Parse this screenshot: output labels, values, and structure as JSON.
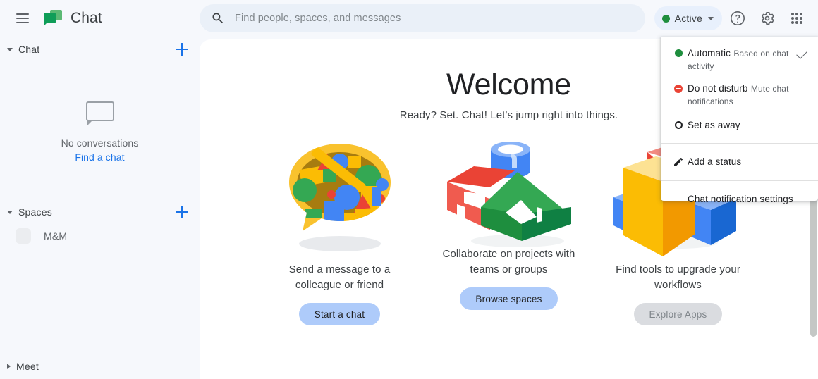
{
  "header": {
    "menu_icon": "hamburger-icon",
    "app_name": "Chat",
    "logo_icon": "google-chat-logo",
    "search": {
      "icon": "search-icon",
      "placeholder": "Find people, spaces, and messages",
      "value": ""
    },
    "status_pill": {
      "label": "Active",
      "dot_color": "#1e8e3e",
      "chevron_icon": "chevron-down-icon"
    },
    "help_icon": "help-circle-icon",
    "settings_icon": "gear-icon",
    "apps_icon": "apps-grid-icon"
  },
  "sidebar": {
    "chat_section": {
      "title": "Chat",
      "expanded": true,
      "add_icon": "plus-icon",
      "empty_state": {
        "icon": "chat-bubble-icon",
        "text": "No conversations",
        "link": "Find a chat"
      }
    },
    "spaces_section": {
      "title": "Spaces",
      "expanded": true,
      "add_icon": "plus-icon",
      "items": [
        {
          "name": "M&M",
          "avatar": "space-avatar"
        }
      ]
    },
    "meet_section": {
      "title": "Meet",
      "expanded": false
    }
  },
  "main": {
    "title": "Welcome",
    "subtitle": "Ready? Set. Chat! Let's jump right into things.",
    "cards": [
      {
        "art": "speech-bubble-with-shapes-illustration",
        "text": "Send a message to a colleague or friend",
        "button": "Start a chat",
        "disabled": false
      },
      {
        "art": "three-3d-shapes-illustration",
        "text": "Collaborate on projects with teams or groups",
        "button": "Browse spaces",
        "disabled": false
      },
      {
        "art": "3d-blocks-illustration",
        "text": "Find tools to upgrade your workflows",
        "button": "Explore Apps",
        "disabled": true
      }
    ]
  },
  "status_menu": {
    "items": [
      {
        "icon": "green-dot-icon",
        "title": "Automatic",
        "subtitle": "Based on chat activity",
        "selected": true
      },
      {
        "icon": "do-not-disturb-icon",
        "title": "Do not disturb",
        "subtitle": "Mute chat notifications",
        "selected": false
      },
      {
        "icon": "away-circle-icon",
        "title": "Set as away",
        "subtitle": "",
        "selected": false
      }
    ],
    "add_status": {
      "icon": "pencil-icon",
      "title": "Add a status"
    },
    "notification_settings": {
      "title": "Chat notification settings"
    }
  },
  "colors": {
    "brand_green": "#0f9d58",
    "accent_blue": "#1a73e8",
    "button_blue": "#aecbfa",
    "page_bg": "#f6f8fc",
    "search_bg": "#eaf0f8"
  }
}
